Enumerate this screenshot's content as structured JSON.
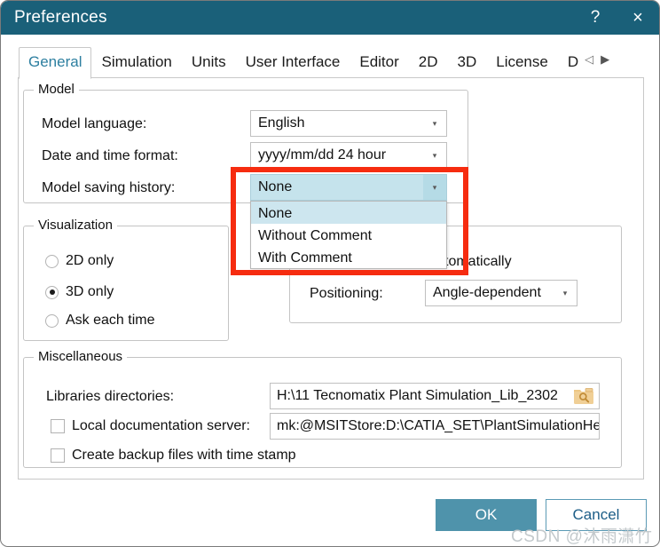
{
  "window": {
    "title": "Preferences",
    "help_label": "?",
    "close_label": "×",
    "accent_color": "#1a6079",
    "highlight_color": "#f62c10"
  },
  "tabs": {
    "items": [
      {
        "label": "General",
        "active": true
      },
      {
        "label": "Simulation",
        "active": false
      },
      {
        "label": "Units",
        "active": false
      },
      {
        "label": "User Interface",
        "active": false
      },
      {
        "label": "Editor",
        "active": false
      },
      {
        "label": "2D",
        "active": false
      },
      {
        "label": "3D",
        "active": false
      },
      {
        "label": "License",
        "active": false
      },
      {
        "label": "D",
        "active": false
      }
    ],
    "scroll_left": "◁",
    "scroll_right": "▶"
  },
  "groups": {
    "model": {
      "title": "Model",
      "fields": {
        "language_label": "Model language:",
        "language_value": "English",
        "datetime_label": "Date and time format:",
        "datetime_value": "yyyy/mm/dd  24 hour",
        "history_label": "Model saving history:",
        "history_value": "None"
      }
    },
    "visualization": {
      "title": "Visualization",
      "options": [
        {
          "label": "2D only",
          "checked": false
        },
        {
          "label": "3D only",
          "checked": true
        },
        {
          "label": "Ask each time",
          "checked": false
        }
      ]
    },
    "right_panel": {
      "partial_label": "tomatically",
      "positioning_label": "Positioning:",
      "positioning_value": "Angle-dependent"
    },
    "miscellaneous": {
      "title": "Miscellaneous",
      "libraries_label": "Libraries directories:",
      "libraries_value": "H:\\11 Tecnomatix Plant Simulation_Lib_2302",
      "browse_icon": "folder-search-icon",
      "docserver_label": "Local documentation server:",
      "docserver_checked": false,
      "docserver_value": "mk:@MSITStore:D:\\CATIA_SET\\PlantSimulationHelp",
      "backup_label": "Create backup files with time stamp",
      "backup_checked": false
    }
  },
  "dropdown": {
    "open": true,
    "selected": "None",
    "arrow": "▾",
    "options": [
      {
        "label": "None",
        "selected": true
      },
      {
        "label": "Without Comment",
        "selected": false
      },
      {
        "label": "With Comment",
        "selected": false
      }
    ]
  },
  "footer": {
    "ok_label": "OK",
    "cancel_label": "Cancel"
  },
  "watermark": {
    "text": "CSDN @沐雨潇竹"
  }
}
